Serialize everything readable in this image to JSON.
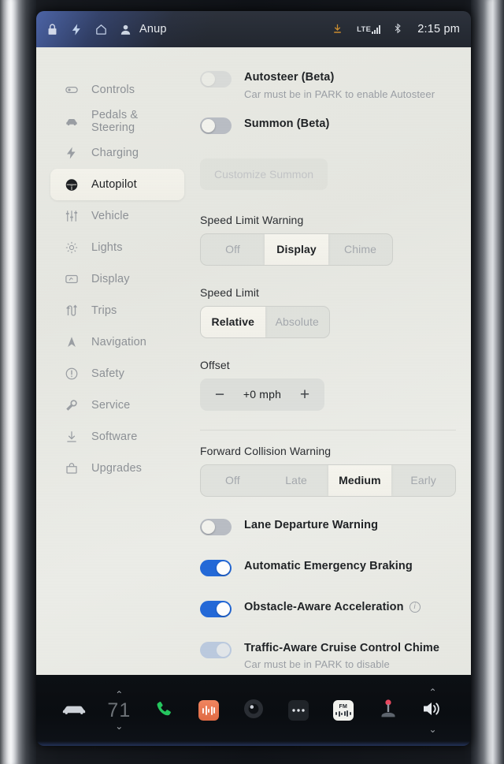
{
  "statusbar": {
    "icons_left": [
      "lock-icon",
      "charging-bolt-icon",
      "home-icon",
      "profile-icon"
    ],
    "profile_name": "Anup",
    "download_icon": "download-icon",
    "network_label": "LTE",
    "bluetooth_icon": "bluetooth-icon",
    "clock": "2:15 pm"
  },
  "sidebar": {
    "items": [
      {
        "label": "Controls",
        "icon": "toggle-icon",
        "active": false
      },
      {
        "label": "Pedals & Steering",
        "icon": "car-icon",
        "active": false
      },
      {
        "label": "Charging",
        "icon": "bolt-icon",
        "active": false
      },
      {
        "label": "Autopilot",
        "icon": "steering-wheel-icon",
        "active": true
      },
      {
        "label": "Vehicle",
        "icon": "sliders-icon",
        "active": false
      },
      {
        "label": "Lights",
        "icon": "sun-icon",
        "active": false
      },
      {
        "label": "Display",
        "icon": "screen-icon",
        "active": false
      },
      {
        "label": "Trips",
        "icon": "route-icon",
        "active": false
      },
      {
        "label": "Navigation",
        "icon": "navigation-arrow-icon",
        "active": false
      },
      {
        "label": "Safety",
        "icon": "alert-circle-icon",
        "active": false
      },
      {
        "label": "Service",
        "icon": "wrench-icon",
        "active": false
      },
      {
        "label": "Software",
        "icon": "download-arrow-icon",
        "active": false
      },
      {
        "label": "Upgrades",
        "icon": "bag-icon",
        "active": false
      }
    ]
  },
  "content": {
    "autosteer": {
      "label": "Autosteer (Beta)",
      "sublabel": "Car must be in PARK to enable Autosteer",
      "state": "off-disabled"
    },
    "summon": {
      "label": "Summon (Beta)",
      "state": "off"
    },
    "customize_summon_button": "Customize Summon",
    "speed_limit_warning": {
      "title": "Speed Limit Warning",
      "options": [
        "Off",
        "Display",
        "Chime"
      ],
      "selected": "Display"
    },
    "speed_limit": {
      "title": "Speed Limit",
      "options": [
        "Relative",
        "Absolute"
      ],
      "selected": "Relative"
    },
    "offset": {
      "title": "Offset",
      "minus_label": "−",
      "value": "+0 mph",
      "plus_label": "+"
    },
    "forward_collision_warning": {
      "title": "Forward Collision Warning",
      "options": [
        "Off",
        "Late",
        "Medium",
        "Early"
      ],
      "selected": "Medium"
    },
    "toggles": [
      {
        "label": "Lane Departure Warning",
        "state": "off",
        "sublabel": "",
        "info": false
      },
      {
        "label": "Automatic Emergency Braking",
        "state": "on",
        "sublabel": "",
        "info": false
      },
      {
        "label": "Obstacle-Aware Acceleration",
        "state": "on",
        "sublabel": "",
        "info": true,
        "info_glyph": "i"
      },
      {
        "label": "Traffic-Aware Cruise Control Chime",
        "state": "on-disabled",
        "sublabel": "Car must be in PARK to disable",
        "info": false
      }
    ]
  },
  "dock": {
    "car_icon": "car-icon",
    "temperature": "71",
    "chevron_up": "⌃",
    "chevron_down": "⌄",
    "phone_icon": "phone-icon",
    "audio_icon": "audio-waveform-icon",
    "camera_icon": "dashcam-icon",
    "more_icon": "more-dots-icon",
    "fm_label": "FM",
    "fm_icon": "fm-radio-icon",
    "arcade_icon": "joystick-icon",
    "volume_icon": "volume-icon"
  },
  "colors": {
    "accent_blue": "#2268d8",
    "screen_bg": "#e8e9e3",
    "selected_seg": "#f4f3ec",
    "dock_bg": "#0b0e12",
    "audio_tile": "#e87550",
    "phone_green": "#25c55e"
  }
}
